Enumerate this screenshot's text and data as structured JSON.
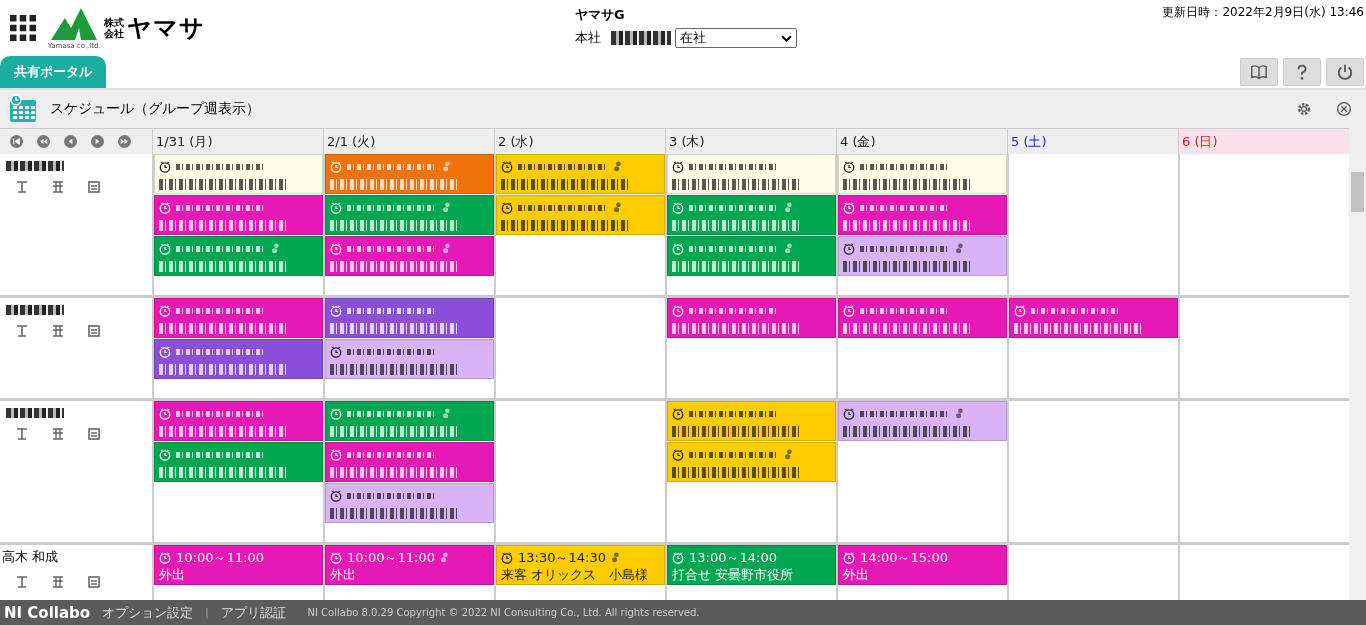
{
  "header": {
    "logo": {
      "prefix_top": "株式",
      "prefix_bottom": "会社",
      "name": "ヤマサ",
      "subtext": "Yamasa co.,ltd."
    },
    "group": "ヤマサG",
    "location": "本社",
    "status": "在社",
    "updated": "更新日時：2022年2月9日(水) 13:46"
  },
  "tabs": [
    {
      "label": "共有ポータル",
      "selected": true
    }
  ],
  "panel": {
    "title": "スケジュール（グループ週表示）"
  },
  "days": [
    {
      "label": "1/31 (月)",
      "kind": "weekday"
    },
    {
      "label": "2/1 (火)",
      "kind": "weekday"
    },
    {
      "label": "2 (水)",
      "kind": "weekday"
    },
    {
      "label": "3 (木)",
      "kind": "weekday"
    },
    {
      "label": "4 (金)",
      "kind": "weekday"
    },
    {
      "label": "5 (土)",
      "kind": "saturday"
    },
    {
      "label": "6 (日)",
      "kind": "sunday"
    }
  ],
  "members": [
    {
      "name_visible": false,
      "cells": [
        [
          {
            "kind": "blurred",
            "color": "#fffde7",
            "people": false
          },
          {
            "kind": "blurred",
            "color": "#e619b7",
            "people": false
          },
          {
            "kind": "blurred",
            "color": "#00a650",
            "people": true
          }
        ],
        [
          {
            "kind": "blurred",
            "color": "#ef7309",
            "people": true
          },
          {
            "kind": "blurred",
            "color": "#00a650",
            "people": true
          },
          {
            "kind": "blurred",
            "color": "#e619b7",
            "people": true
          }
        ],
        [
          {
            "kind": "blurred",
            "color": "#ffcc00",
            "people": true
          },
          {
            "kind": "blurred",
            "color": "#ffcc00",
            "people": true
          }
        ],
        [
          {
            "kind": "blurred",
            "color": "#fffde7",
            "people": false
          },
          {
            "kind": "blurred",
            "color": "#00a650",
            "people": true
          },
          {
            "kind": "blurred",
            "color": "#00a650",
            "people": true
          }
        ],
        [
          {
            "kind": "blurred",
            "color": "#fffde7",
            "people": false
          },
          {
            "kind": "blurred",
            "color": "#e619b7",
            "people": false
          },
          {
            "kind": "blurred",
            "color": "#d8b3f5",
            "people": true
          }
        ],
        [],
        []
      ]
    },
    {
      "name_visible": false,
      "cells": [
        [
          {
            "kind": "blurred",
            "color": "#e619b7",
            "people": false
          },
          {
            "kind": "blurred",
            "color": "#8a4fd6",
            "people": false
          }
        ],
        [
          {
            "kind": "blurred",
            "color": "#8a4fd6",
            "people": false
          },
          {
            "kind": "blurred",
            "color": "#d8b3f5",
            "people": false
          }
        ],
        [],
        [
          {
            "kind": "blurred",
            "color": "#e619b7",
            "people": false
          }
        ],
        [
          {
            "kind": "blurred",
            "color": "#e619b7",
            "people": false
          }
        ],
        [
          {
            "kind": "blurred",
            "color": "#e619b7",
            "people": false
          }
        ],
        []
      ]
    },
    {
      "name_visible": false,
      "cells": [
        [
          {
            "kind": "blurred",
            "color": "#e619b7",
            "people": false
          },
          {
            "kind": "blurred",
            "color": "#00a650",
            "people": false
          }
        ],
        [
          {
            "kind": "blurred",
            "color": "#00a650",
            "people": true
          },
          {
            "kind": "blurred",
            "color": "#e619b7",
            "people": false
          },
          {
            "kind": "blurred",
            "color": "#d8b3f5",
            "people": false
          }
        ],
        [],
        [
          {
            "kind": "blurred",
            "color": "#ffcc00",
            "people": false
          },
          {
            "kind": "blurred",
            "color": "#ffcc00",
            "people": true
          }
        ],
        [
          {
            "kind": "blurred",
            "color": "#d8b3f5",
            "people": true
          }
        ],
        [],
        []
      ]
    },
    {
      "name_visible": true,
      "name": "高木 和成",
      "cells": [
        [
          {
            "kind": "event",
            "color": "#e619b7",
            "people": false,
            "time": "10:00～11:00",
            "title": "外出"
          }
        ],
        [
          {
            "kind": "event",
            "color": "#e619b7",
            "people": true,
            "time": "10:00～11:00",
            "title": "外出"
          }
        ],
        [
          {
            "kind": "event",
            "color": "#ffcc00",
            "people": true,
            "time": "13:30～14:30",
            "title": "来客 オリックス　小島様"
          }
        ],
        [
          {
            "kind": "event",
            "color": "#00a650",
            "people": false,
            "time": "13:00～14:00",
            "title": "打合せ 安曇野市役所"
          }
        ],
        [
          {
            "kind": "event",
            "color": "#e619b7",
            "people": false,
            "time": "14:00～15:00",
            "title": "外出"
          }
        ],
        [],
        []
      ]
    }
  ],
  "footer": {
    "brand": "NI Collabo",
    "links": [
      "オプション設定",
      "アプリ認証"
    ],
    "separator": "|",
    "copyright": "NI Collabo 8.0.29 Copyright © 2022 NI Consulting Co., Ltd. All rights reserved."
  }
}
